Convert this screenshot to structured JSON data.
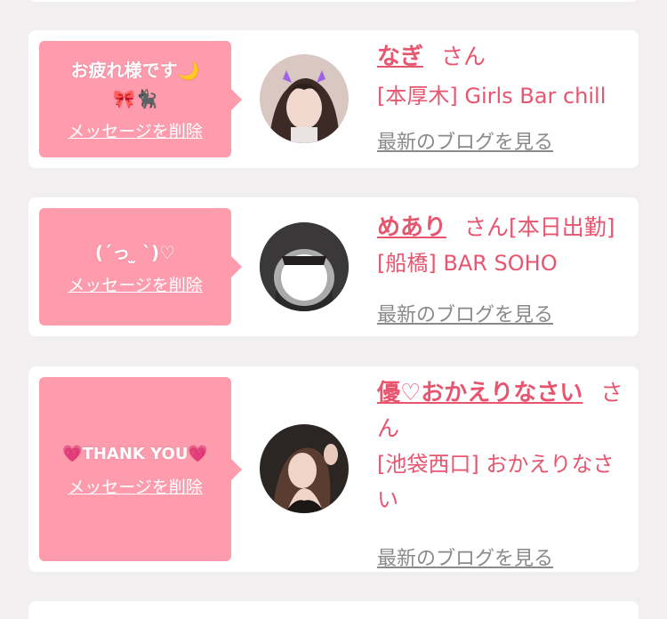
{
  "messages": [
    {
      "text_line1": "お疲れ様です🌙",
      "text_line2": "🎀🐈‍⬛",
      "delete_label": "メッセージを削除",
      "name": "なぎ",
      "honorific": "さん",
      "shop": "[本厚木] Girls Bar chill",
      "blog_label": "最新のブログを見る"
    },
    {
      "text_line1": "(ˊっ ̫ ˋ)♡",
      "delete_label": "メッセージを削除",
      "name": "めあり",
      "honorific": "さん[本日出勤]",
      "shop": "[船橋] BAR SOHO",
      "blog_label": "最新のブログを見る"
    },
    {
      "text_line1": "💗THANK YOU💗",
      "delete_label": "メッセージを削除",
      "name": "優♡おかえりなさい",
      "honorific": "さん",
      "shop": "[池袋西口] おかえりなさい",
      "blog_label": "最新のブログを見る"
    }
  ],
  "colors": {
    "accent": "#e8556f",
    "bubble": "#fe9cae",
    "background": "#f1eff0",
    "link_gray": "#8a8a8a"
  }
}
